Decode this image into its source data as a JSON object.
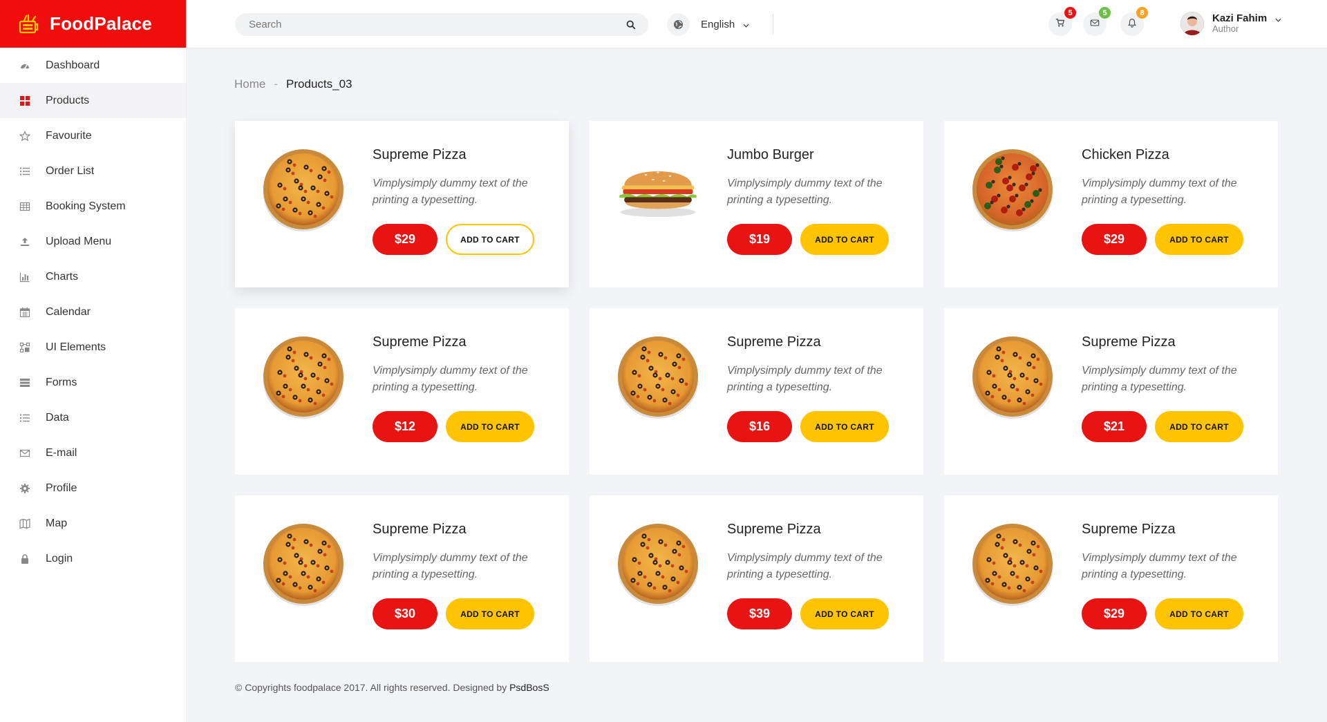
{
  "brand": {
    "name": "FoodPalace",
    "color": "#f20d0d"
  },
  "sidebar": {
    "items": [
      {
        "label": "Dashboard",
        "icon": "dashboard-icon"
      },
      {
        "label": "Products",
        "icon": "grid-icon",
        "active": true
      },
      {
        "label": "Favourite",
        "icon": "star-icon"
      },
      {
        "label": "Order List",
        "icon": "list-icon"
      },
      {
        "label": "Booking System",
        "icon": "table-icon"
      },
      {
        "label": "Upload Menu",
        "icon": "upload-icon"
      },
      {
        "label": "Charts",
        "icon": "bar-chart-icon"
      },
      {
        "label": "Calendar",
        "icon": "calendar-icon"
      },
      {
        "label": "UI Elements",
        "icon": "ui-elements-icon"
      },
      {
        "label": "Forms",
        "icon": "forms-icon"
      },
      {
        "label": "Data",
        "icon": "list-icon"
      },
      {
        "label": "E-mail",
        "icon": "mail-icon"
      },
      {
        "label": "Profile",
        "icon": "gear-icon"
      },
      {
        "label": "Map",
        "icon": "map-icon"
      },
      {
        "label": "Login",
        "icon": "lock-icon"
      }
    ]
  },
  "header": {
    "search_placeholder": "Search",
    "language": "English",
    "cart_count": "5",
    "mail_count": "5",
    "notification_count": "8",
    "user_name": "Kazi Fahim",
    "user_role": "Author"
  },
  "breadcrumb": {
    "home": "Home",
    "separator": "-",
    "current": "Products_03"
  },
  "products": [
    {
      "title": "Supreme Pizza",
      "desc": "Vimplysimply dummy text of the printing a typesetting.",
      "price": "$29",
      "cta": "ADD TO CART",
      "image": "pizza",
      "featured": true
    },
    {
      "title": "Jumbo Burger",
      "desc": "Vimplysimply dummy text of the printing a typesetting.",
      "price": "$19",
      "cta": "ADD TO CART",
      "image": "burger"
    },
    {
      "title": "Chicken Pizza",
      "desc": "Vimplysimply dummy text of the printing a typesetting.",
      "price": "$29",
      "cta": "ADD TO CART",
      "image": "chicken-pizza"
    },
    {
      "title": "Supreme Pizza",
      "desc": "Vimplysimply dummy text of the printing a typesetting.",
      "price": "$12",
      "cta": "ADD TO CART",
      "image": "pizza"
    },
    {
      "title": "Supreme Pizza",
      "desc": "Vimplysimply dummy text of the printing a typesetting.",
      "price": "$16",
      "cta": "ADD TO CART",
      "image": "pizza"
    },
    {
      "title": "Supreme Pizza",
      "desc": "Vimplysimply dummy text of the printing a typesetting.",
      "price": "$21",
      "cta": "ADD TO CART",
      "image": "pizza"
    },
    {
      "title": "Supreme Pizza",
      "desc": "Vimplysimply dummy text of the printing a typesetting.",
      "price": "$30",
      "cta": "ADD TO CART",
      "image": "pizza"
    },
    {
      "title": "Supreme Pizza",
      "desc": "Vimplysimply dummy text of the printing a typesetting.",
      "price": "$39",
      "cta": "ADD TO CART",
      "image": "pizza"
    },
    {
      "title": "Supreme Pizza",
      "desc": "Vimplysimply dummy text of the printing a typesetting.",
      "price": "$29",
      "cta": "ADD TO CART",
      "image": "pizza"
    }
  ],
  "footer": {
    "text": "© Copyrights foodpalace 2017. All rights reserved. Designed by",
    "designer": "PsdBosS"
  },
  "colors": {
    "primary_red": "#e81313",
    "accent_yellow": "#ffc400",
    "badge_red": "#e81313",
    "badge_green": "#6cc04a",
    "badge_orange": "#f7a325"
  }
}
